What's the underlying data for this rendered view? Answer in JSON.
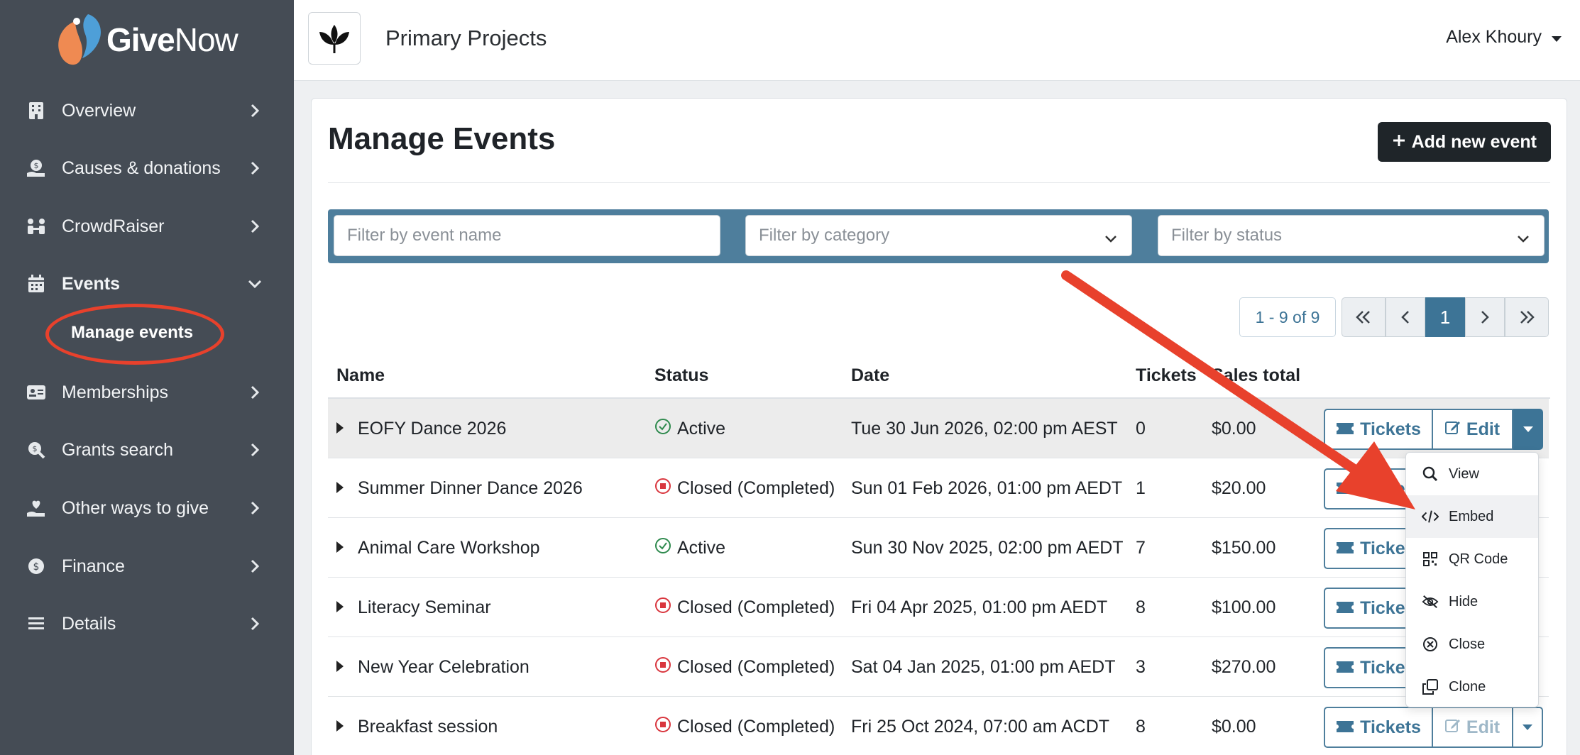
{
  "brand": {
    "logo_give": "Give",
    "logo_now": "Now"
  },
  "sidebar": {
    "items": [
      {
        "label": "Overview",
        "icon": "building-icon"
      },
      {
        "label": "Causes & donations",
        "icon": "hand-dollar-icon"
      },
      {
        "label": "CrowdRaiser",
        "icon": "people-icon"
      },
      {
        "label": "Events",
        "icon": "calendar-icon"
      },
      {
        "label": "Memberships",
        "icon": "id-card-icon"
      },
      {
        "label": "Grants search",
        "icon": "search-dollar-icon"
      },
      {
        "label": "Other ways to give",
        "icon": "hand-heart-icon"
      },
      {
        "label": "Finance",
        "icon": "coin-icon"
      },
      {
        "label": "Details",
        "icon": "list-icon"
      }
    ],
    "sub_item": "Manage events",
    "annotation_color": "#e8412c"
  },
  "topbar": {
    "org_name": "Primary Projects",
    "user_name": "Alex Khoury"
  },
  "main": {
    "title": "Manage Events",
    "add_button": "Add new event",
    "filters": {
      "name_placeholder": "Filter by event name",
      "category_placeholder": "Filter by category",
      "status_placeholder": "Filter by status"
    },
    "pagination": {
      "info": "1 - 9 of 9",
      "current": "1"
    },
    "columns": [
      "Name",
      "Status",
      "Date",
      "Tickets",
      "Sales total"
    ],
    "rows": [
      {
        "name": "EOFY Dance 2026",
        "status": "Active",
        "date": "Tue 30 Jun 2026, 02:00 pm AEST",
        "tickets": "0",
        "sales": "$0.00"
      },
      {
        "name": "Summer Dinner Dance 2026",
        "status": "Closed (Completed)",
        "date": "Sun 01 Feb 2026, 01:00 pm AEDT",
        "tickets": "1",
        "sales": "$20.00"
      },
      {
        "name": "Animal Care Workshop",
        "status": "Active",
        "date": "Sun 30 Nov 2025, 02:00 pm AEDT",
        "tickets": "7",
        "sales": "$150.00"
      },
      {
        "name": "Literacy Seminar",
        "status": "Closed (Completed)",
        "date": "Fri 04 Apr 2025, 01:00 pm AEDT",
        "tickets": "8",
        "sales": "$100.00"
      },
      {
        "name": "New Year Celebration",
        "status": "Closed (Completed)",
        "date": "Sat 04 Jan 2025, 01:00 pm AEDT",
        "tickets": "3",
        "sales": "$270.00"
      },
      {
        "name": "Breakfast session",
        "status": "Closed (Completed)",
        "date": "Fri 25 Oct 2024, 07:00 am ACDT",
        "tickets": "8",
        "sales": "$0.00"
      }
    ],
    "row_buttons": {
      "tickets": "Tickets",
      "edit": "Edit"
    },
    "dropdown_menu": [
      "View",
      "Embed",
      "QR Code",
      "Hide",
      "Close",
      "Clone"
    ]
  },
  "colors": {
    "sidebar": "#454c55",
    "primary": "#3d7496",
    "active_status": "#2f8a4e",
    "closed_status": "#d9363e"
  }
}
